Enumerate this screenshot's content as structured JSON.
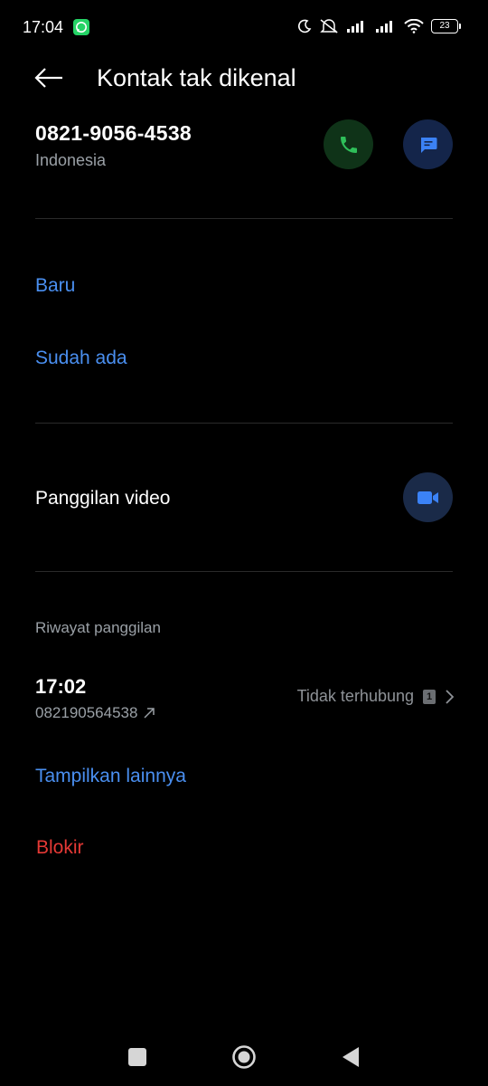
{
  "status_bar": {
    "time": "17:04",
    "battery": "23",
    "icons": [
      "whatsapp-icon",
      "moon-icon",
      "mute-icon",
      "signal-icon",
      "signal-icon",
      "wifi-icon",
      "battery-icon"
    ]
  },
  "header": {
    "title": "Kontak tak dikenal",
    "back_icon": "arrow-left-icon"
  },
  "contact": {
    "number": "0821-9056-4538",
    "country": "Indonesia",
    "call_icon": "phone-icon",
    "message_icon": "message-icon"
  },
  "add_contact": {
    "new_label": "Baru",
    "existing_label": "Sudah ada"
  },
  "video": {
    "label": "Panggilan video",
    "icon": "video-camera-icon"
  },
  "history": {
    "title": "Riwayat panggilan",
    "entries": [
      {
        "time": "17:02",
        "number": "082190564538",
        "status": "Tidak terhubung",
        "sim": "1"
      }
    ],
    "show_more": "Tampilkan lainnya"
  },
  "block_label": "Blokir",
  "colors": {
    "accent_blue": "#4a8ff0",
    "danger_red": "#e53935",
    "call_green": "#2fbf5a"
  }
}
